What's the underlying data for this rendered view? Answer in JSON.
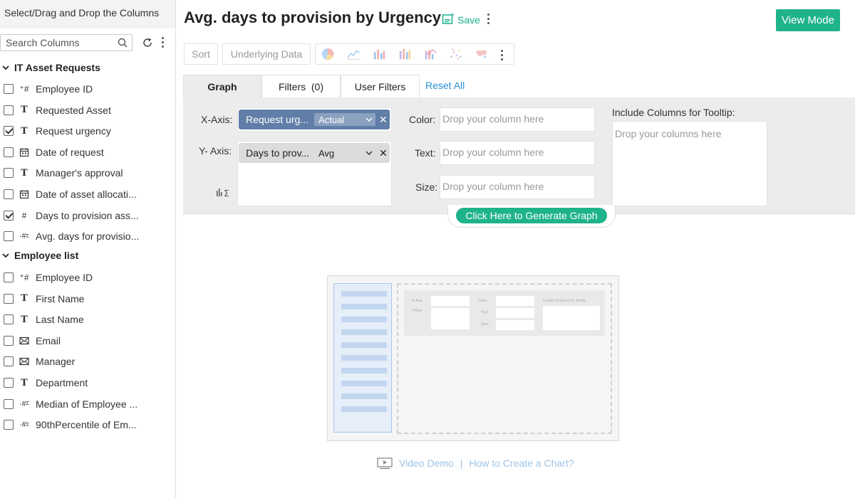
{
  "left_panel": {
    "header": "Select/Drag and Drop the Columns",
    "search_placeholder": "Search Columns",
    "groups": [
      {
        "name": "IT Asset Requests",
        "fields": [
          {
            "type": "num-key",
            "label": "Employee ID",
            "checked": false
          },
          {
            "type": "text",
            "label": "Requested Asset",
            "checked": false
          },
          {
            "type": "text",
            "label": "Request urgency",
            "checked": true
          },
          {
            "type": "date",
            "label": "Date of request",
            "checked": false
          },
          {
            "type": "text",
            "label": "Manager's approval",
            "checked": false
          },
          {
            "type": "date",
            "label": "Date of asset allocati...",
            "checked": false
          },
          {
            "type": "num",
            "label": "Days to provision ass...",
            "checked": true
          },
          {
            "type": "formula",
            "label": "Avg. days for provisio...",
            "checked": false
          }
        ]
      },
      {
        "name": "Employee list",
        "fields": [
          {
            "type": "num-key",
            "label": "Employee ID",
            "checked": false
          },
          {
            "type": "text",
            "label": "First Name",
            "checked": false
          },
          {
            "type": "text",
            "label": "Last Name",
            "checked": false
          },
          {
            "type": "email",
            "label": "Email",
            "checked": false
          },
          {
            "type": "email",
            "label": "Manager",
            "checked": false
          },
          {
            "type": "text",
            "label": "Department",
            "checked": false
          },
          {
            "type": "formula",
            "label": "Median of Employee ...",
            "checked": false
          },
          {
            "type": "formula",
            "label": "90thPercentile of Em...",
            "checked": false
          }
        ]
      }
    ]
  },
  "header": {
    "title": "Avg. days to provision by Urgency",
    "save_label": "Save",
    "view_mode_label": "View Mode"
  },
  "toolbar": {
    "sort_label": "Sort",
    "underlying_label": "Underlying Data"
  },
  "tabs": {
    "graph": "Graph",
    "filters": "Filters  (0)",
    "user_filters": "User Filters",
    "reset_all": "Reset All"
  },
  "builder": {
    "x_axis_label": "X-Axis:",
    "y_axis_label": "Y- Axis:",
    "x_pill": {
      "name": "Request urg...",
      "agg": "Actual"
    },
    "y_pill": {
      "name": "Days to prov...",
      "agg": "Avg"
    },
    "color_label": "Color:",
    "text_label": "Text:",
    "size_label": "Size:",
    "drop_placeholder": "Drop your column here",
    "tooltip_label": "Include Columns for Tooltip:",
    "tooltip_placeholder": "Drop your columns here",
    "generate_label": "Click Here to Generate Graph"
  },
  "illustration": {
    "x_axis": "X-Axis:",
    "y_axis": "Y-Axis:",
    "color": "Color:",
    "text": "Text:",
    "size": "Size:",
    "tooltip": "Include Columns for Tooltip"
  },
  "help": {
    "video_demo": "Video Demo",
    "how_to": "How to Create a Chart?"
  }
}
